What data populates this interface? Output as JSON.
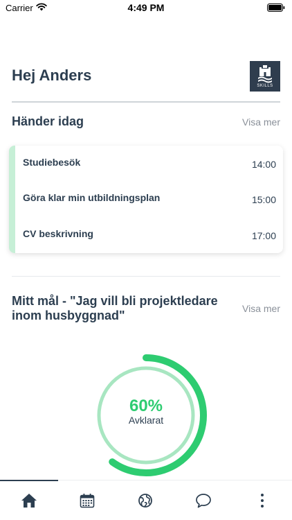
{
  "status_bar": {
    "carrier": "Carrier",
    "time": "4:49 PM"
  },
  "header": {
    "greeting": "Hej Anders",
    "logo_text": "SKILLS"
  },
  "today": {
    "title": "Händer idag",
    "more_label": "Visa mer",
    "events": [
      {
        "name": "Studiebesök",
        "time": "14:00"
      },
      {
        "name": "Göra klar min utbildningsplan",
        "time": "15:00"
      },
      {
        "name": "CV beskrivning",
        "time": "17:00"
      }
    ]
  },
  "goal": {
    "title": "Mitt mål - \"Jag vill bli projektledare inom husbyggnad\"",
    "more_label": "Visa mer",
    "progress_text": "60%",
    "progress_value": 0.6,
    "progress_label": "Avklarat"
  },
  "tabs": [
    {
      "icon": "home-icon",
      "active": true
    },
    {
      "icon": "calendar-icon",
      "active": false
    },
    {
      "icon": "globe-icon",
      "active": false
    },
    {
      "icon": "chat-icon",
      "active": false
    },
    {
      "icon": "more-vertical-icon",
      "active": false
    }
  ],
  "colors": {
    "primary": "#2c3e50",
    "accent_green": "#2ecc71",
    "light_green": "#a8e6c1",
    "card_accent": "#c6efd6",
    "logo_bg": "#2f3d4e"
  }
}
